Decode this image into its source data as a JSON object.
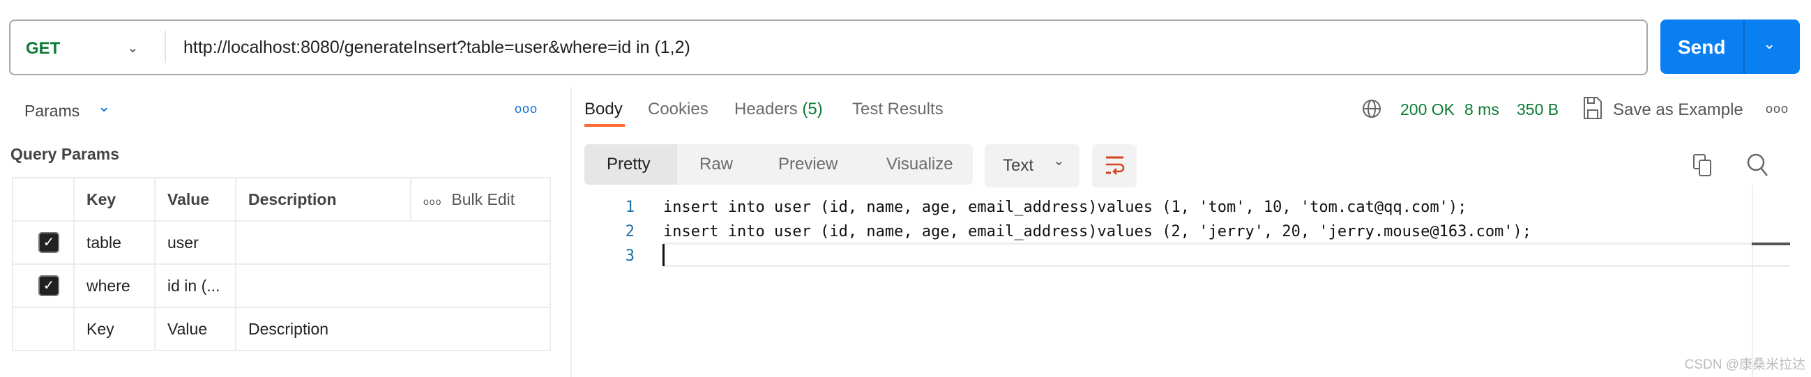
{
  "request": {
    "method": "GET",
    "url": "http://localhost:8080/generateInsert?table=user&where=id in (1,2)",
    "send_label": "Send"
  },
  "left": {
    "params_label": "Params",
    "query_params_title": "Query Params",
    "table": {
      "headers": [
        "Key",
        "Value",
        "Description"
      ],
      "bulk_edit": "Bulk Edit",
      "rows": [
        {
          "checked": true,
          "key": "table",
          "value": "user",
          "description": ""
        },
        {
          "checked": true,
          "key": "where",
          "value": "id in (...",
          "description": ""
        }
      ],
      "placeholder": {
        "key": "Key",
        "value": "Value",
        "description": "Description"
      }
    }
  },
  "response": {
    "tabs": [
      "Body",
      "Cookies",
      "Headers",
      "(5)",
      "Test Results"
    ],
    "active_tab": "Body",
    "status": "200 OK",
    "time": "8 ms",
    "size": "350 B",
    "save_example": "Save as Example",
    "formats": [
      "Pretty",
      "Raw",
      "Preview",
      "Visualize"
    ],
    "active_format": "Pretty",
    "language": "Text",
    "code": [
      "insert into user (id, name, age, email_address)values (1, 'tom', 10, 'tom.cat@qq.com');",
      "insert into user (id, name, age, email_address)values (2, 'jerry', 20, 'jerry.mouse@163.com');",
      ""
    ],
    "line_numbers": [
      "1",
      "2",
      "3"
    ]
  },
  "colors": {
    "accent": "#0a7ff2",
    "method": "#0b7a34",
    "tab_underline": "#ff6c37",
    "status": "#0b7a34"
  },
  "watermark": "CSDN @康桑米拉达"
}
